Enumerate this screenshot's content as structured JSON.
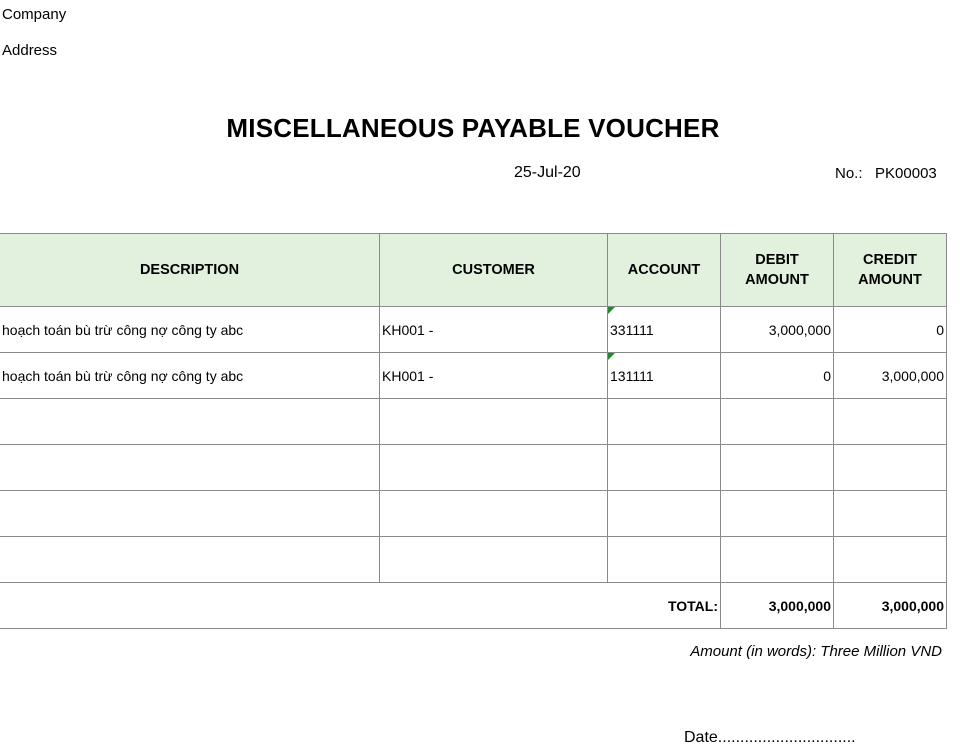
{
  "header": {
    "company_label": "Company",
    "address_label": "Address",
    "title": "MISCELLANEOUS PAYABLE VOUCHER",
    "date": "25-Jul-20",
    "number_label": "No.:",
    "number_value": "PK00003"
  },
  "table": {
    "columns": [
      "DESCRIPTION",
      "CUSTOMER",
      "ACCOUNT",
      "DEBIT AMOUNT",
      "CREDIT AMOUNT"
    ],
    "rows": [
      {
        "description": "hoạch toán bù trừ công nợ công ty abc",
        "customer": "KH001 -",
        "account": "331111",
        "debit": "3,000,000",
        "credit": "0"
      },
      {
        "description": "hoạch toán bù trừ công nợ công ty abc",
        "customer": "KH001 -",
        "account": "131111",
        "debit": "0",
        "credit": "3,000,000"
      }
    ],
    "total_label": "TOTAL:",
    "total_debit": "3,000,000",
    "total_credit": "3,000,000",
    "note_color": "#1e8c2a",
    "header_bg": "#e2f0de"
  },
  "footer": {
    "amount_in_words": "Amount (in words): Three Million VND",
    "date_line": "Date..............................."
  }
}
